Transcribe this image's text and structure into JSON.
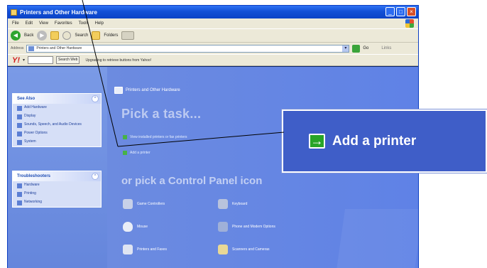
{
  "window": {
    "title": "Printers and Other Hardware",
    "buttons": {
      "minimize": "_",
      "maximize": "□",
      "close": "×"
    }
  },
  "menubar": {
    "items": [
      "File",
      "Edit",
      "View",
      "Favorites",
      "Tools",
      "Help"
    ]
  },
  "toolbar": {
    "back": "Back",
    "search": "Search",
    "folders": "Folders"
  },
  "addressbar": {
    "label": "Address",
    "value": "Printers and Other Hardware",
    "go": "Go",
    "links": "Links"
  },
  "yahoo": {
    "logo": "Y!",
    "search_button": "Search Web",
    "message": "Upgrading to retrieve buttons from Yahoo!"
  },
  "sidebar": {
    "panels": [
      {
        "title": "See Also",
        "items": [
          "Add Hardware",
          "Display",
          "Sounds, Speech, and Audio Devices",
          "Power Options",
          "System"
        ]
      },
      {
        "title": "Troubleshooters",
        "items": [
          "Hardware",
          "Printing",
          "Networking"
        ]
      }
    ]
  },
  "main": {
    "header": "Printers and Other Hardware",
    "pick_task": "Pick a task...",
    "tasks": [
      "View installed printers or fax printers",
      "Add a printer"
    ],
    "pick_icon": "or pick a Control Panel icon",
    "categories": [
      "Game Controllers",
      "Keyboard",
      "Mouse",
      "Phone and Modem Options",
      "Printers and Faxes",
      "Scanners and Cameras"
    ]
  },
  "callout": {
    "label": "Add a printer"
  },
  "colors": {
    "title_bar": "#1250d6",
    "content_bg": "#6c8be0",
    "callout_bg": "#3f5ec8",
    "task_icon": "#47b247"
  }
}
